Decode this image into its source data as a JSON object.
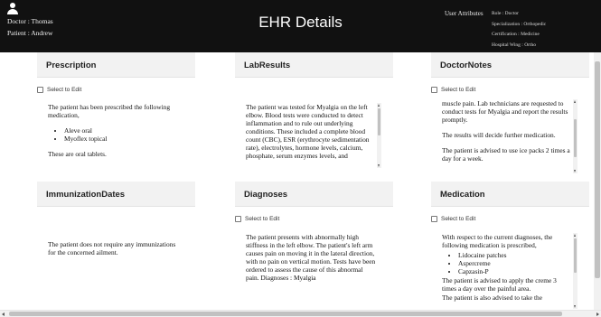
{
  "header": {
    "doctor_line": "Doctor : Thomas",
    "patient_line": "Patient : Andrew",
    "title": "EHR Details",
    "user_attributes_label": "User Attributes",
    "attributes": [
      "Role : Doctor",
      "Specialization : Orthopedic",
      "Certification : Medicine",
      "Hospital Wing : Ortho"
    ]
  },
  "panels": {
    "prescription": {
      "title": "Prescription",
      "select_label": "Select to Edit",
      "intro": "The patient has been prescribed the following medication,",
      "items": [
        "Aleve oral",
        "Myoflex topical"
      ],
      "outro": "These are oral tablets."
    },
    "lab_results": {
      "title": "LabResults",
      "text": "The patient was tested for Myalgia on the left elbow. Blood tests were conducted to detect inflammation and to rule out underlying conditions. These included a complete blood count (CBC), ESR (erythrocyte sedimentation rate), electrolytes, hormone levels, calcium, phosphate, serum enzymes levels, and"
    },
    "doctor_notes": {
      "title": "DoctorNotes",
      "select_label": "Select to Edit",
      "p1": "muscle pain. Lab technicians are requested to conduct tests for Myalgia and report the results promptly.",
      "p2": "The results will decide further medication.",
      "p3": "The patient is advised to use ice packs 2 times a day for a week."
    },
    "immunization": {
      "title": "ImmunizationDates",
      "text": "The patient does not require any immunizations for the concerned ailment."
    },
    "diagnoses": {
      "title": "Diagnoses",
      "select_label": "Select to Edit",
      "text": "The patient presents with abnormally high stiffness in the left elbow. The patient's left arm causes pain on moving it in the lateral direction, with no pain on vertical motion. Tests have been ordered to assess the cause of this abnormal pain. Diagnoses : Myalgia"
    },
    "medication": {
      "title": "Medication",
      "select_label": "Select to Edit",
      "intro": "With respect to the current diagnoses, the following medication is prescribed,",
      "items": [
        "Lidocaine patches",
        "Aspercreme",
        "Capzasin-P"
      ],
      "p2": "The patient is advised to apply the creme 3 times a day over the painful area.",
      "p3": "The patient is also advised to take the"
    }
  }
}
